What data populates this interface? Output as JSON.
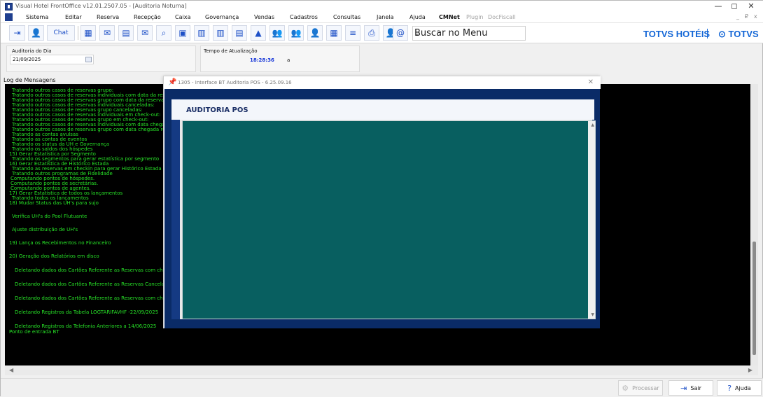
{
  "window": {
    "title": "Visual Hotel FrontOffice v12.01.2507.05 - [Auditoria Noturna]",
    "min": "—",
    "max": "◻",
    "close": "✕"
  },
  "menus": [
    "Sistema",
    "Editar",
    "Reserva",
    "Recepção",
    "Caixa",
    "Governança",
    "Vendas",
    "Cadastros",
    "Consultas",
    "Janela",
    "Ajuda"
  ],
  "menu_extra": {
    "cmnet": "CMNet",
    "plugin": "Plugin",
    "docfiscall": "DocFiscall"
  },
  "mdi_controls": [
    "_",
    "₽",
    "x"
  ],
  "toolbar": {
    "chat_label": "Chat",
    "search_menu": "Buscar no Menu",
    "logo_hotel": "TOTVS HOTÉIS",
    "logo_totvs": "TOTVS"
  },
  "top_panel": {
    "audit_label": "Auditoria do Dia",
    "audit_date": "21/09/2025",
    "update_label": "Tempo de Atualização",
    "time": "18:28:36",
    "time_suffix": "a"
  },
  "log": {
    "label": "Log de Mensagens",
    "lines": [
      "Tratando outros casos de reservas grupo:",
      "Tratando outros casos de reservas individuais com data da reser",
      "Tratando outros casos de reservas grupo com data da reserva e",
      "Tratando outros casos de reservas individuais canceladas:",
      "Tratando outros casos de reservas grupo canceladas:",
      "Tratando outros casos de reservas individuais em check-out:",
      "Tratando outros casos de reservas grupo em check-out:",
      "Tratando outros casos de reservas individuais com data chegad",
      "Tratando outros casos de reservas grupo com data chegada re",
      "Tratando as contas avulsas",
      "Tratando as contas de eventos",
      "Tratando os status da UH e Governança",
      "Tratando os saldos dos hóspedes",
      "15) Gerar Estatística por Segmento",
      "Tratando os segmentos para gerar estatística por segmento",
      "16) Gerar Estatística de Histórico Estada",
      "Tratando as reservas em checkin para gerar Histórico Estada",
      "Tratando outros programas de Fidelidade",
      "Computando pontos de hóspedes.",
      "Computando pontos de secretárias.",
      "Computando pontos de agentes.",
      "17) Gerar Estatística de todos os lançamentos",
      "Tratando todos os lançamentos",
      "18) Mudar Status das UH's para sujo",
      "Verifica UH's do Pool Flutuante",
      "Ajuste distribuição de UH's",
      "19) Lança os Recebimentos no Financeiro",
      "20) Geração dos Relatórios em disco",
      "Deletando dados dos Cartões Referente as Reservas com che",
      "Deletando dados dos Cartões Referente as Reservas Cancela",
      "Deletando dados dos Cartões Referente as Reservas com che",
      "Deletando Registros da Tabela LOGTARIFAVHF -22/09/2025",
      "Deletando Registros da Telefonia Anteriores a 14/06/2025",
      "Ponto de entrada BT"
    ]
  },
  "dialog": {
    "title": "1305 - Interface BT Auditoria POS - 6.25.09.16",
    "header": "AUDITORIA POS",
    "close": "✕"
  },
  "bottom": {
    "processar": "Processar",
    "sair": "Sair",
    "ajuda": "Ajuda"
  }
}
